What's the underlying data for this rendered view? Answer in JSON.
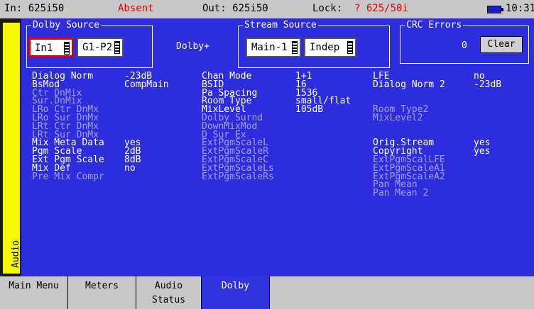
{
  "status": {
    "input": "In: 625i50",
    "signal": "Absent",
    "output": "Out: 625i50",
    "lock_prefix": "Lock: ",
    "lock_value": "? 625/50i",
    "time": "10:31",
    "battery_icon": "battery-icon"
  },
  "side_tab": "Audio",
  "dolby_source": {
    "legend": "Dolby Source",
    "input": "In1",
    "pair": "G1-P2"
  },
  "format": "Dolby+",
  "stream_source": {
    "legend": "Stream Source",
    "program": "Main-1",
    "mode": "Indep"
  },
  "crc": {
    "legend": "CRC Errors",
    "count": "0",
    "clear": "Clear"
  },
  "params": {
    "col1": [
      {
        "label": "Dialog Norm",
        "value": "-23dB"
      },
      {
        "label": "BsMod",
        "value": "CompMain"
      },
      {
        "label": "Ctr DnMix",
        "value": ""
      },
      {
        "label": "Sur.DnMix",
        "value": ""
      },
      {
        "label": "LRo Ctr DnMx",
        "value": ""
      },
      {
        "label": "LRo Sur DnMx",
        "value": ""
      },
      {
        "label": "LRt Ctr DnMx",
        "value": ""
      },
      {
        "label": "LRt Sur DnMx",
        "value": ""
      },
      {
        "label": "Mix Meta Data",
        "value": "yes"
      },
      {
        "label": "Pgm Scale",
        "value": "2dB"
      },
      {
        "label": "Ext Pgm Scale",
        "value": "8dB"
      },
      {
        "label": "Mix Def",
        "value": "no"
      },
      {
        "label": "Pre Mix Compr",
        "value": ""
      }
    ],
    "col2": [
      {
        "label": "Chan Mode",
        "value": "1+1"
      },
      {
        "label": "BSID",
        "value": "16"
      },
      {
        "label": "Pa Spacing",
        "value": "1536"
      },
      {
        "label": "Room Type",
        "value": "small/flat"
      },
      {
        "label": "MixLevel",
        "value": "105dB"
      },
      {
        "label": "Dolby Surnd",
        "value": ""
      },
      {
        "label": "DownMixMod",
        "value": ""
      },
      {
        "label": "D Sur Ex",
        "value": ""
      },
      {
        "label": "ExtPgmScaleL",
        "value": ""
      },
      {
        "label": "ExtPgmScaleR",
        "value": ""
      },
      {
        "label": "ExtPgmScaleC",
        "value": ""
      },
      {
        "label": "ExtPgmScaleLs",
        "value": ""
      },
      {
        "label": "ExtPgmScaleRs",
        "value": ""
      }
    ],
    "col3": [
      {
        "label": "LFE",
        "value": "no"
      },
      {
        "label": "Dialog Norm 2",
        "value": "-23dB"
      },
      {
        "label": "Room Type2",
        "value": ""
      },
      {
        "label": "MixLevel2",
        "value": ""
      },
      {
        "label": "Orig.Stream",
        "value": "yes"
      },
      {
        "label": "Copyright",
        "value": "yes"
      },
      {
        "label": "ExtPgmScalLFE",
        "value": ""
      },
      {
        "label": "ExtPgmScaleA1",
        "value": ""
      },
      {
        "label": "ExtPgmScaleA2",
        "value": ""
      },
      {
        "label": "Pan Mean",
        "value": ""
      },
      {
        "label": "Pan Mean 2",
        "value": ""
      }
    ]
  },
  "tabs": [
    {
      "line1": "Main Menu",
      "line2": ""
    },
    {
      "line1": "Meters",
      "line2": ""
    },
    {
      "line1": "Audio",
      "line2": "Status"
    },
    {
      "line1": "Dolby",
      "line2": ""
    }
  ],
  "colors": {
    "panel": "#2d2dde",
    "accent": "#f7f700",
    "alert": "#e00000"
  }
}
